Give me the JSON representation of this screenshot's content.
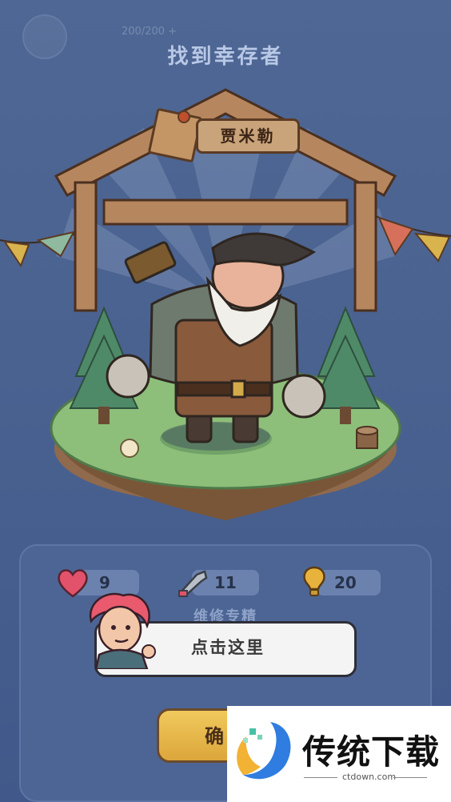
{
  "header": {
    "title": "找到幸存者",
    "faded_stats": "200/200 +"
  },
  "survivor": {
    "name": "贾米勒"
  },
  "stats": {
    "health": "9",
    "attack": "11",
    "resource": "20"
  },
  "skill_label": "维修专精",
  "tooltip": {
    "text": "点击这里"
  },
  "confirm_button": {
    "label": "确"
  },
  "watermark": {
    "text": "传统下载",
    "url": "ctdown.com"
  },
  "colors": {
    "background": "#4a6290",
    "panel": "#4d6594",
    "button": "#e6b64a",
    "heart": "#e2536b"
  },
  "icons": [
    "avatar-icon",
    "heart-icon",
    "wrench-icon",
    "lightbulb-icon",
    "watermark-logo-icon"
  ]
}
